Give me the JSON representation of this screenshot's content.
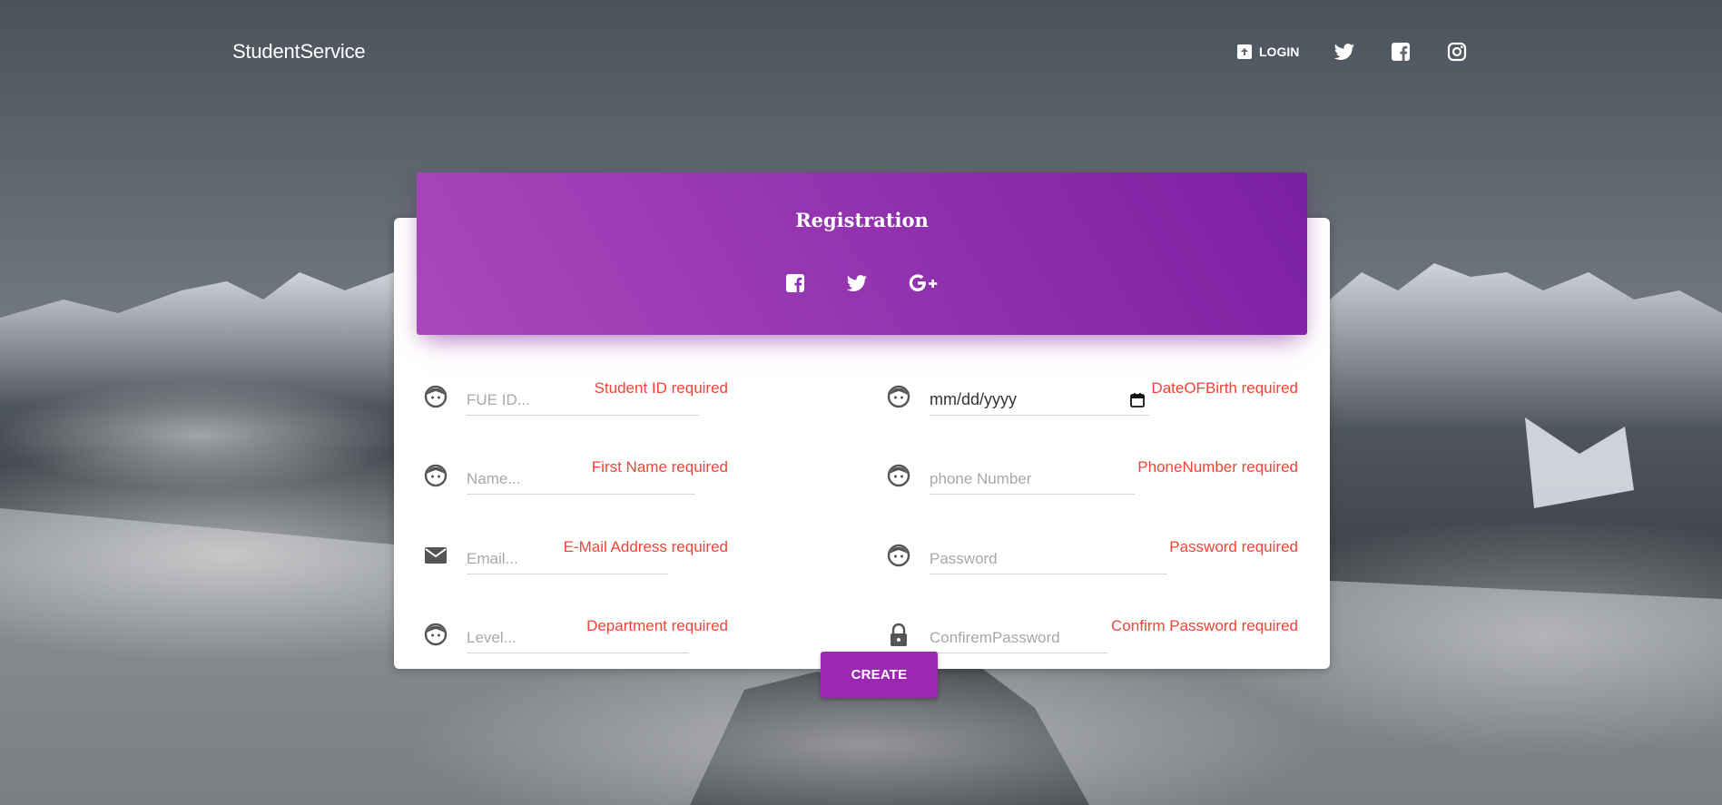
{
  "nav": {
    "brand": "StudentService",
    "login_label": "LOGIN",
    "icons": [
      "login-icon",
      "twitter-icon",
      "facebook-icon",
      "instagram-icon"
    ]
  },
  "card": {
    "title": "Registration",
    "social_icons": [
      "facebook-icon",
      "twitter-icon",
      "google-plus-icon"
    ]
  },
  "fields": {
    "student_id": {
      "placeholder": "FUE ID...",
      "error": "Student ID required",
      "icon": "face-icon"
    },
    "name": {
      "placeholder": "Name...",
      "error": "First Name required",
      "icon": "face-icon"
    },
    "email": {
      "placeholder": "Email...",
      "error": "E-Mail Address required",
      "icon": "mail-icon"
    },
    "level": {
      "placeholder": "Level...",
      "error": "Department required",
      "icon": "face-icon"
    },
    "dob": {
      "value": "mm/dd/yyyy",
      "error": "DateOFBirth required",
      "icon": "face-icon"
    },
    "phone": {
      "placeholder": "phone Number",
      "error": "PhoneNumber required",
      "icon": "face-icon"
    },
    "password": {
      "placeholder": "Password",
      "error": "Password required",
      "icon": "face-icon"
    },
    "confirm_password": {
      "placeholder": "ConfiremPassword",
      "error": "Confirm Password required",
      "icon": "lock-icon"
    }
  },
  "create_label": "CREATE",
  "colors": {
    "accent": "#9c27b0",
    "accent_dark": "#7b1fa2",
    "error": "#f44336"
  }
}
